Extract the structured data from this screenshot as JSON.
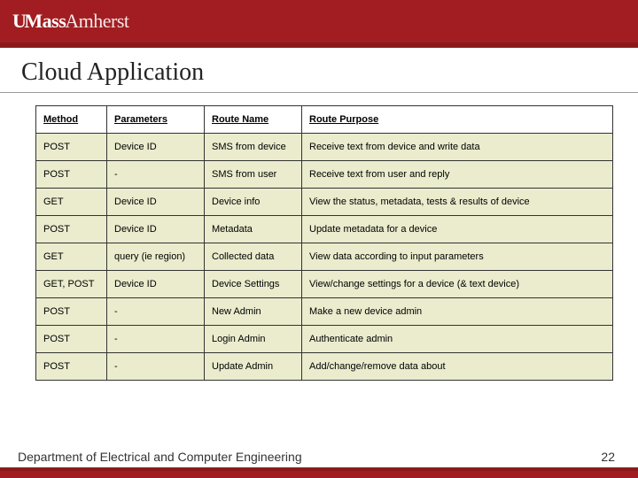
{
  "header": {
    "logo_u": "U",
    "logo_mass": "Mass",
    "logo_amherst": "Amherst"
  },
  "title": "Cloud Application",
  "table": {
    "headers": {
      "method": "Method",
      "parameters": "Parameters",
      "route_name": "Route Name",
      "route_purpose": "Route Purpose"
    },
    "rows": [
      {
        "method": "POST",
        "parameters": "Device ID",
        "route_name": "SMS from device",
        "route_purpose": "Receive text from device and write data"
      },
      {
        "method": "POST",
        "parameters": "-",
        "route_name": "SMS from user",
        "route_purpose": "Receive text from user and reply"
      },
      {
        "method": "GET",
        "parameters": "Device ID",
        "route_name": "Device info",
        "route_purpose": "View the status, metadata, tests & results of device"
      },
      {
        "method": "POST",
        "parameters": "Device ID",
        "route_name": "Metadata",
        "route_purpose": "Update metadata for a device"
      },
      {
        "method": "GET",
        "parameters": "query (ie region)",
        "route_name": "Collected data",
        "route_purpose": "View data according to input parameters"
      },
      {
        "method": "GET, POST",
        "parameters": "Device ID",
        "route_name": "Device Settings",
        "route_purpose": "View/change settings for a device (& text device)"
      },
      {
        "method": "POST",
        "parameters": "-",
        "route_name": "New Admin",
        "route_purpose": "Make a new device admin"
      },
      {
        "method": "POST",
        "parameters": "-",
        "route_name": "Login Admin",
        "route_purpose": "Authenticate admin"
      },
      {
        "method": "POST",
        "parameters": "-",
        "route_name": "Update Admin",
        "route_purpose": "Add/change/remove data about"
      }
    ]
  },
  "footer": {
    "department": "Department of Electrical and Computer Engineering",
    "page": "22"
  }
}
